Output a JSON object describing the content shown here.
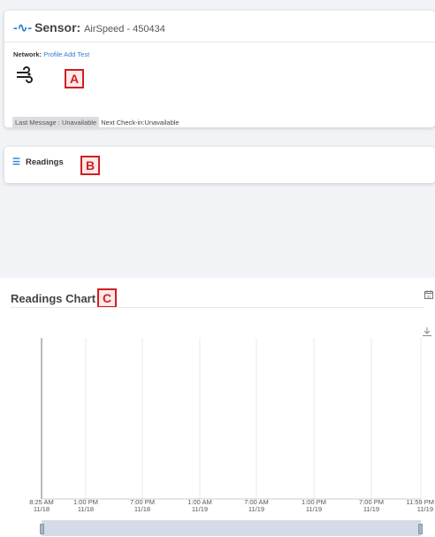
{
  "sensor": {
    "title_label": "Sensor:",
    "name": "AirSpeed - 450434",
    "network_label": "Network:",
    "network_value": "Profile Add Test",
    "last_message": "Last Message : Unavailable",
    "next_checkin": "Next Check-in:Unavailable",
    "icon": "wind-icon",
    "callout": "A"
  },
  "readings": {
    "title": "Readings",
    "icon": "list-icon",
    "callout": "B"
  },
  "readings_chart": {
    "title": "Readings Chart",
    "callout": "C",
    "calendar_icon_text": "31"
  },
  "chart_data": {
    "type": "line",
    "x_ticks": [
      {
        "time": "8:25 AM",
        "date": "11/18"
      },
      {
        "time": "1:00 PM",
        "date": "11/18"
      },
      {
        "time": "7:00 PM",
        "date": "11/18"
      },
      {
        "time": "1:00 AM",
        "date": "11/19"
      },
      {
        "time": "7:00 AM",
        "date": "11/19"
      },
      {
        "time": "1:00 PM",
        "date": "11/19"
      },
      {
        "time": "7:00 PM",
        "date": "11/19"
      },
      {
        "time": "11:59 PM",
        "date": "11/19"
      }
    ],
    "series": [],
    "grid": true
  },
  "colors": {
    "accent": "#2b7fd1",
    "callout": "#d11f1f"
  }
}
